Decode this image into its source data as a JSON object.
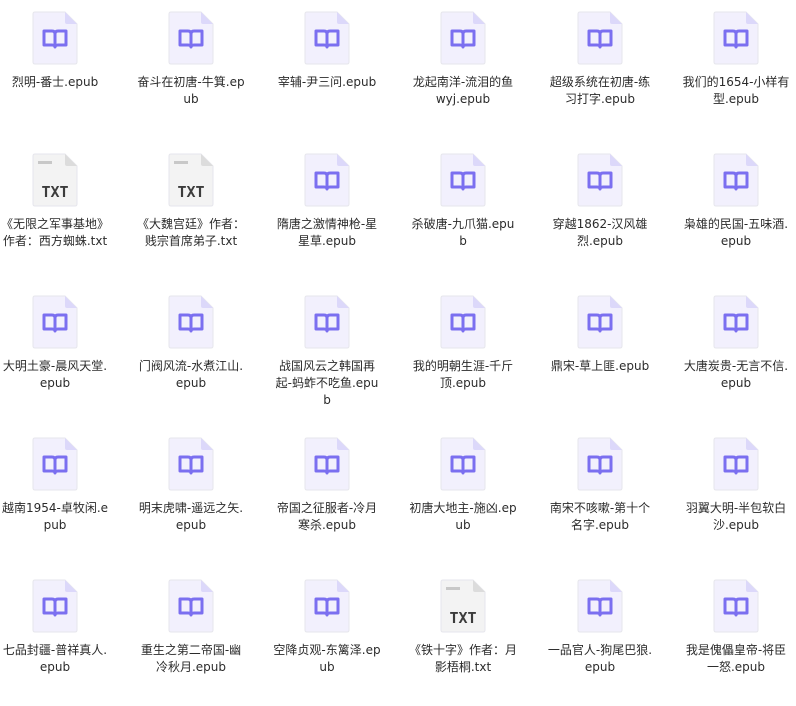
{
  "files": [
    {
      "name": "烈明-番士.epub",
      "type": "epub"
    },
    {
      "name": "奋斗在初唐-牛箕.epub",
      "type": "epub"
    },
    {
      "name": "宰辅-尹三问.epub",
      "type": "epub"
    },
    {
      "name": "龙起南洋-流泪的鱼wyj.epub",
      "type": "epub"
    },
    {
      "name": "超级系统在初唐-练习打字.epub",
      "type": "epub"
    },
    {
      "name": "我们的1654-小样有型.epub",
      "type": "epub"
    },
    {
      "name": "《无限之军事基地》作者：西方蜘蛛.txt",
      "type": "txt"
    },
    {
      "name": "《大魏宫廷》作者：贱宗首席弟子.txt",
      "type": "txt"
    },
    {
      "name": "隋唐之激情神枪-星星草.epub",
      "type": "epub"
    },
    {
      "name": "杀破唐-九爪猫.epub",
      "type": "epub"
    },
    {
      "name": "穿越1862-汉风雄烈.epub",
      "type": "epub"
    },
    {
      "name": "枭雄的民国-五味酒.epub",
      "type": "epub"
    },
    {
      "name": "大明土豪-晨风天堂.epub",
      "type": "epub"
    },
    {
      "name": "门阀风流-水煮江山.epub",
      "type": "epub"
    },
    {
      "name": "战国风云之韩国再起-蚂蚱不吃鱼.epub",
      "type": "epub"
    },
    {
      "name": "我的明朝生涯-千斤顶.epub",
      "type": "epub"
    },
    {
      "name": "鼎宋-草上匪.epub",
      "type": "epub"
    },
    {
      "name": "大唐炭贵-无言不信.epub",
      "type": "epub"
    },
    {
      "name": "越南1954-卓牧闲.epub",
      "type": "epub"
    },
    {
      "name": "明末虎啸-遥远之矢.epub",
      "type": "epub"
    },
    {
      "name": "帝国之征服者-冷月寒杀.epub",
      "type": "epub"
    },
    {
      "name": "初唐大地主-施凶.epub",
      "type": "epub"
    },
    {
      "name": "南宋不咳嗽-第十个名字.epub",
      "type": "epub"
    },
    {
      "name": "羽翼大明-半包软白沙.epub",
      "type": "epub"
    },
    {
      "name": "七品封疆-普祥真人.epub",
      "type": "epub"
    },
    {
      "name": "重生之第二帝国-幽冷秋月.epub",
      "type": "epub"
    },
    {
      "name": "空降贞观-东篱泽.epub",
      "type": "epub"
    },
    {
      "name": "《铁十字》作者：月影梧桐.txt",
      "type": "txt"
    },
    {
      "name": "一品官人-狗尾巴狼.epub",
      "type": "epub"
    },
    {
      "name": "我是傀儡皇帝-将臣一怒.epub",
      "type": "epub"
    }
  ],
  "icons": {
    "epub": {
      "name": "epub-book-icon",
      "color": "#7b6ff0",
      "bg": "#f2f0fd",
      "fold": "#dcd8fa"
    },
    "txt": {
      "name": "txt-file-icon",
      "label": "TXT",
      "color": "#3c3c3c",
      "bg": "#f3f3f3",
      "fold": "#dcdcdc"
    }
  }
}
